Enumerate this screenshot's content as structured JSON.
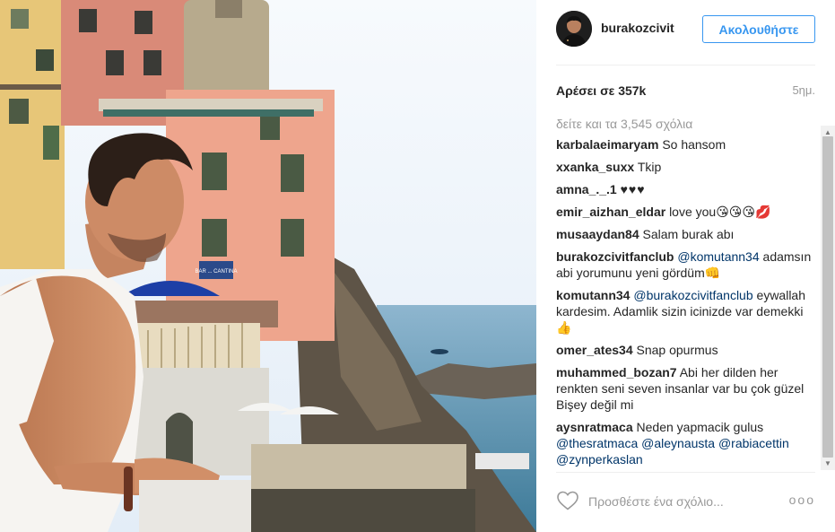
{
  "post": {
    "username": "burakozcivit",
    "follow_label": "Ακολουθήστε",
    "likes": "Αρέσει σε 357k",
    "time": "5ημ.",
    "view_all": "δείτε και τα 3,545 σχόλια",
    "comment_placeholder": "Προσθέστε ένα σχόλιο...",
    "more_label": "ooo"
  },
  "comments": [
    {
      "user": "karbalaeimaryam",
      "text": "So hansom"
    },
    {
      "user": "xxanka_suxx",
      "text": "Tkip"
    },
    {
      "user": "amna_._.1",
      "text": "♥♥♥"
    },
    {
      "user": "emir_aizhan_eldar",
      "text": "love you😘😘😘💋"
    },
    {
      "user": "musaaydan84",
      "text": "Salam burak abı"
    },
    {
      "user": "burakozcivitfanclub",
      "mention": "@komutann34",
      "text": "adamsın abi yorumunu yeni gördüm👊"
    },
    {
      "user": "komutann34",
      "mention": "@burakozcivitfanclub",
      "text": "eywallah kardesim. Adamlik sizin icinizde var demekki 👍"
    },
    {
      "user": "omer_ates34",
      "text": "Snap opurmus"
    },
    {
      "user": "muhammed_bozan7",
      "text": "Abi her dilden her renkten seni seven insanlar var bu çok güzel Bişey değil mi"
    },
    {
      "user": "aysnratmaca",
      "text": "Neden yapmacik gulus",
      "mentions": "@thesratmaca @aleynausta @rabiacettin @zynperkaslan"
    }
  ],
  "photo": {
    "sign_text": "BAR ... CANTINA"
  },
  "colors": {
    "accent": "#3897f0",
    "mention": "#003569",
    "muted": "#999999"
  }
}
